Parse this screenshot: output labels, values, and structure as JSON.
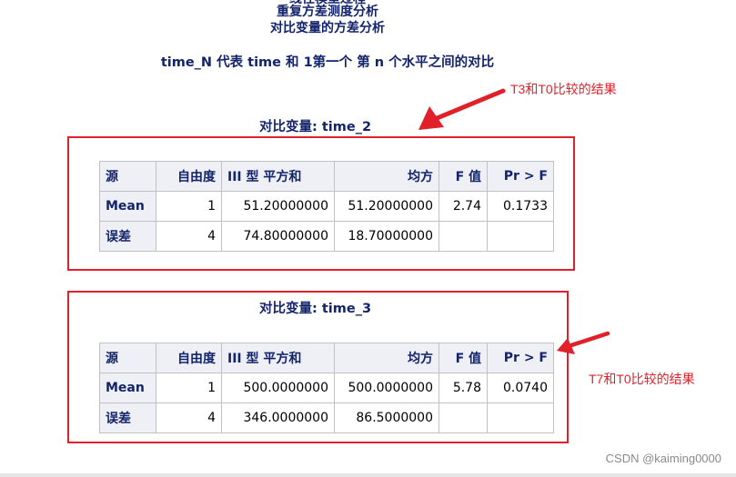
{
  "header": {
    "cut_line": "线性模型过程",
    "line1": "重复方差测度分析",
    "line2": "对比变量的方差分析",
    "line3": "time_N 代表 time 和 1第一个 第 n 个水平之间的对比"
  },
  "columns": [
    "源",
    "自由度",
    "III 型 平方和",
    "均方",
    "F 值",
    "Pr > F"
  ],
  "tables": [
    {
      "title": "对比变量: time_2",
      "rows": [
        {
          "source": "Mean",
          "df": "1",
          "ss": "51.20000000",
          "ms": "51.20000000",
          "f": "2.74",
          "p": "0.1733"
        },
        {
          "source": "误差",
          "df": "4",
          "ss": "74.80000000",
          "ms": "18.70000000",
          "f": "",
          "p": ""
        }
      ]
    },
    {
      "title": "对比变量: time_3",
      "rows": [
        {
          "source": "Mean",
          "df": "1",
          "ss": "500.0000000",
          "ms": "500.0000000",
          "f": "5.78",
          "p": "0.0740"
        },
        {
          "source": "误差",
          "df": "4",
          "ss": "346.0000000",
          "ms": "86.5000000",
          "f": "",
          "p": ""
        }
      ]
    }
  ],
  "annotations": {
    "first": "T3和T0比较的结果",
    "second": "T7和T0比较的结果"
  },
  "watermark": "CSDN @kaiming0000",
  "colors": {
    "heading": "#13246b",
    "annotation": "#e0212a",
    "header_cell": "#eef0f6",
    "border": "#c1c1c1"
  }
}
